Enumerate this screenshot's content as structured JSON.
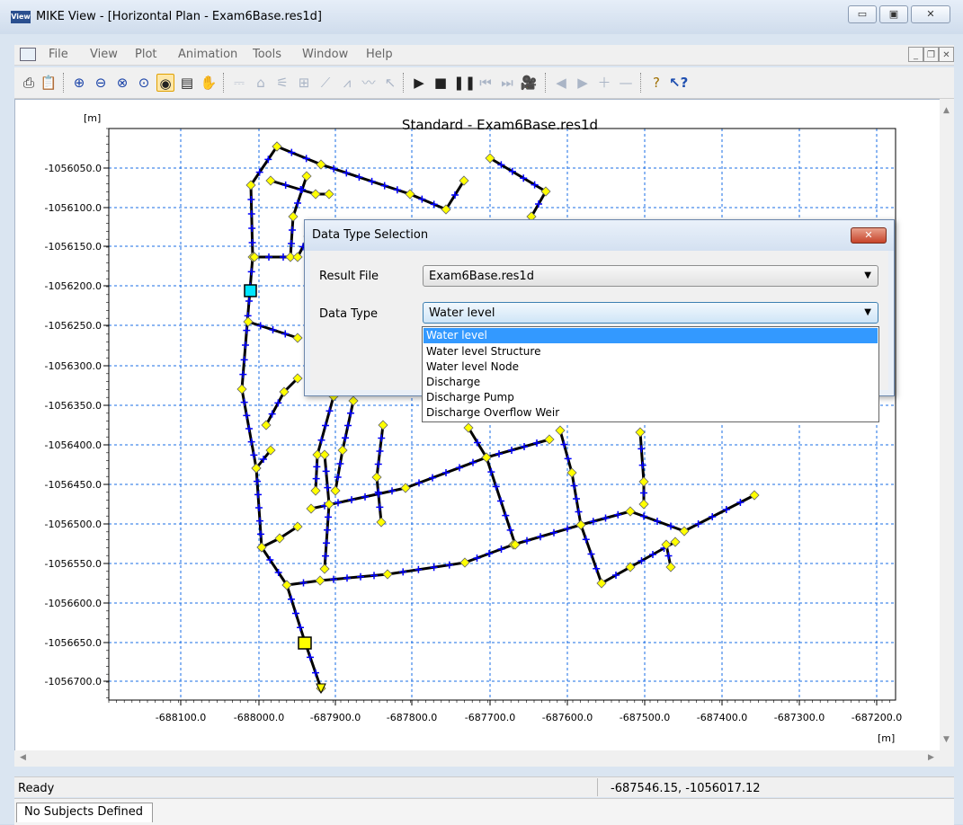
{
  "window": {
    "title": "MIKE View - [Horizontal Plan - Exam6Base.res1d]",
    "app_icon_text": "View"
  },
  "menu": {
    "items": [
      "File",
      "View",
      "Plot",
      "Animation",
      "Tools",
      "Window",
      "Help"
    ]
  },
  "toolbar": {
    "icons": [
      "print-icon",
      "clipboard-icon",
      "zoom-in-icon",
      "zoom-out-icon",
      "zoom-previous-icon",
      "zoom-extents-icon",
      "colour-select-icon",
      "properties-icon",
      "pan-hand-icon",
      "node-select-icon",
      "reach-select-icon",
      "reach-icon",
      "table-icon",
      "graph-icon",
      "area-graph-icon",
      "longitudinal-icon",
      "pointer-icon",
      "play-icon",
      "stop-icon",
      "pause-icon",
      "skip-back-icon",
      "skip-forward-icon",
      "video-icon",
      "step-back-icon",
      "step-forward-icon",
      "plus-icon",
      "minus-icon",
      "help-icon",
      "context-help-icon"
    ]
  },
  "plot": {
    "title": "Standard - Exam6Base.res1d",
    "x_unit": "[m]",
    "y_unit": "[m]",
    "y_ticks": [
      "-1056050.0",
      "-1056100.0",
      "-1056150.0",
      "-1056200.0",
      "-1056250.0",
      "-1056300.0",
      "-1056350.0",
      "-1056400.0",
      "-1056450.0",
      "-1056500.0",
      "-1056550.0",
      "-1056600.0",
      "-1056650.0",
      "-1056700.0"
    ],
    "x_ticks": [
      "-688100.0",
      "-688000.0",
      "-687900.0",
      "-687800.0",
      "-687700.0",
      "-687600.0",
      "-687500.0",
      "-687400.0",
      "-687300.0",
      "-687200.0"
    ],
    "colors": {
      "grid": "#1a6ee6",
      "network": "#000000",
      "node": "#ffff00",
      "calc_point": "#0000ff"
    }
  },
  "dialog": {
    "title": "Data Type Selection",
    "result_file_label": "Result File",
    "result_file_value": "Exam6Base.res1d",
    "data_type_label": "Data Type",
    "data_type_value": "Water level",
    "options": [
      "Water level",
      "Water level Structure",
      "Water level Node",
      "Discharge",
      "Discharge Pump",
      "Discharge Overflow Weir"
    ],
    "selected_index": 0
  },
  "status": {
    "ready": "Ready",
    "coordinates": "-687546.15, -1056017.12"
  },
  "bottom_tab": "No Subjects Defined"
}
